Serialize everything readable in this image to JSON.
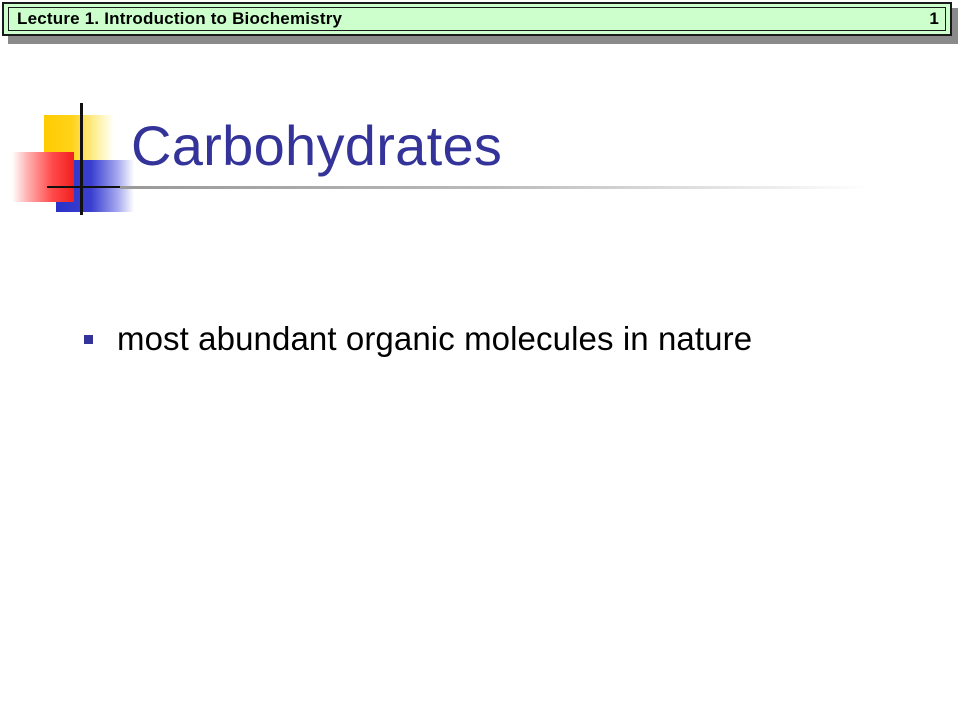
{
  "header": {
    "title": "Lecture 1. Introduction to Biochemistry",
    "page_number": "1",
    "background_color": "#ccffcc"
  },
  "slide": {
    "title": "Carbohydrates",
    "title_color": "#333399",
    "bullets": [
      {
        "text": "most abundant organic molecules in nature"
      }
    ]
  },
  "colors": {
    "bullet": "#333399",
    "logo_yellow": "#ffcc00",
    "logo_blue": "#2a32c8",
    "logo_red": "#f21e1e"
  }
}
